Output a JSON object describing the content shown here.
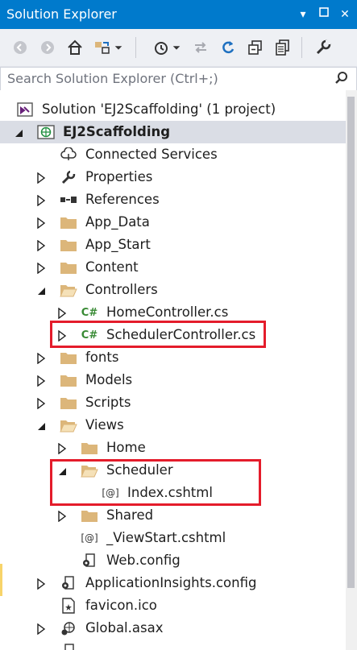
{
  "window": {
    "title": "Solution Explorer"
  },
  "toolbar": {
    "buttons": [
      "back-icon",
      "forward-icon",
      "home-icon",
      "switch-views-icon",
      "pending-changes-icon",
      "sync-icon",
      "refresh-icon",
      "collapse-all-icon",
      "show-all-files-icon",
      "properties-icon"
    ]
  },
  "search": {
    "placeholder": "Search Solution Explorer (Ctrl+;)"
  },
  "tree": {
    "solution": "Solution 'EJ2Scaffolding' (1 project)",
    "project": "EJ2Scaffolding",
    "items": {
      "connected_services": "Connected Services",
      "properties": "Properties",
      "references": "References",
      "app_data": "App_Data",
      "app_start": "App_Start",
      "content": "Content",
      "controllers": "Controllers",
      "home_controller": "HomeController.cs",
      "scheduler_controller": "SchedulerController.cs",
      "fonts": "fonts",
      "models": "Models",
      "scripts": "Scripts",
      "views": "Views",
      "home": "Home",
      "scheduler": "Scheduler",
      "index": "Index.cshtml",
      "shared": "Shared",
      "viewstart": "_ViewStart.cshtml",
      "webconfig_views": "Web.config",
      "appinsights": "ApplicationInsights.config",
      "favicon": "favicon.ico",
      "global": "Global.asax"
    }
  },
  "colors": {
    "accent": "#007acc",
    "selection": "#dadde5",
    "highlight": "#e41c2b",
    "folder": "#dcb67a"
  }
}
